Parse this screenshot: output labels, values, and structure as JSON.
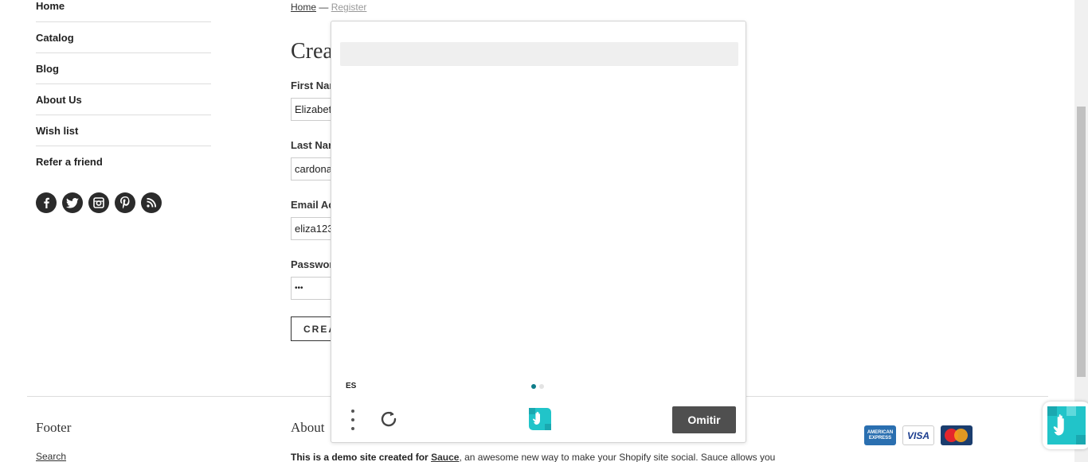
{
  "sidebar": {
    "items": [
      {
        "label": "Home"
      },
      {
        "label": "Catalog"
      },
      {
        "label": "Blog"
      },
      {
        "label": "About Us"
      },
      {
        "label": "Wish list"
      },
      {
        "label": "Refer a friend"
      }
    ],
    "social_icons": [
      "facebook-icon",
      "twitter-icon",
      "instagram-icon",
      "pinterest-icon",
      "rss-icon"
    ]
  },
  "breadcrumb": {
    "home": "Home",
    "separator": "—",
    "current": "Register"
  },
  "form": {
    "title": "Crea",
    "first_name_label": "First Nar",
    "first_name_value": "Elizabet",
    "last_name_label": "Last Nar",
    "last_name_value": "cardona",
    "email_label": "Email Ac",
    "email_value": "eliza123",
    "password_label": "Passwor",
    "password_value": "•••",
    "create_button": "CREA"
  },
  "footer": {
    "title": "Footer",
    "search_link": "Search",
    "about_title": "About",
    "about_text_bold": "This is a demo site created for",
    "about_link": "Sauce",
    "about_text_rest": ", an awesome new way to make your Shopify site social. Sauce allows you",
    "payment_cards": [
      "american-express",
      "visa",
      "mastercard"
    ]
  },
  "modal": {
    "language": "ES",
    "skip_button": "Omitir",
    "pagination": {
      "current": 1,
      "total": 2
    }
  },
  "colors": {
    "accent": "#0e7d8a",
    "skip_button_bg": "#4f4f4f",
    "logo_teal": "#21c4c9"
  }
}
